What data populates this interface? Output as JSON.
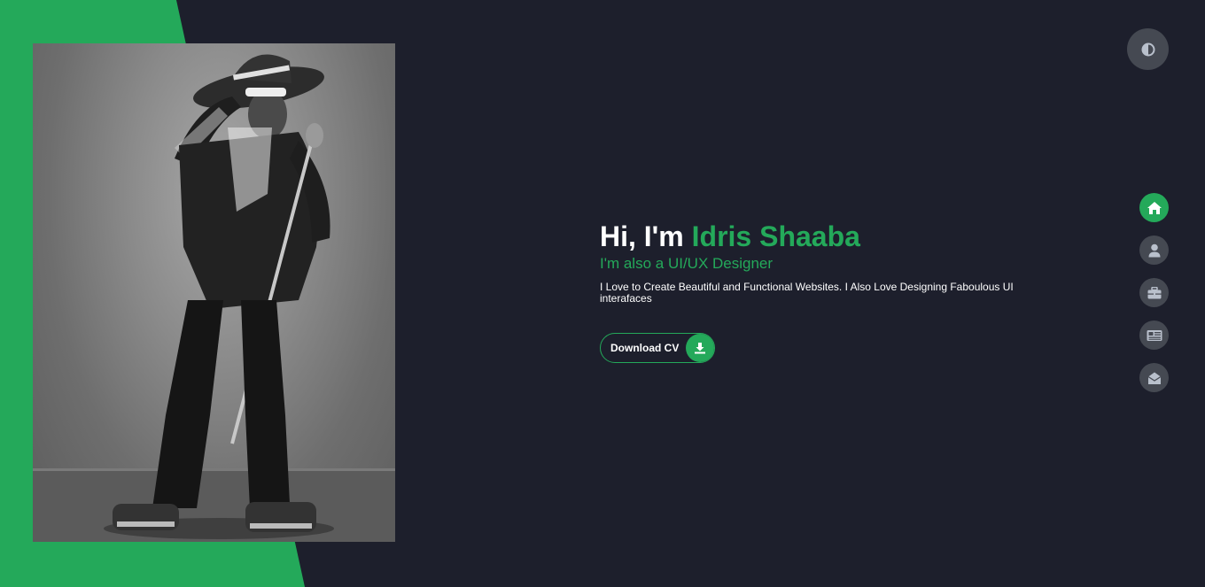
{
  "colors": {
    "accent": "#24a95a",
    "background": "#1d1f2c",
    "nav_button": "#454952",
    "icon_muted": "#b9c0cc",
    "text": "#ffffff"
  },
  "hero": {
    "greeting": "Hi, I'm",
    "name": "Idris Shaaba",
    "subtitle": "I'm also a UI/UX Designer",
    "description": "I Love to Create Beautiful and Functional Websites. I Also Love Designing Faboulous UI interafaces",
    "cta_label": "Download CV",
    "cta_icon": "download-icon"
  },
  "theme_toggle": {
    "icon": "contrast-icon"
  },
  "nav": {
    "items": [
      {
        "icon": "home-icon",
        "active": true
      },
      {
        "icon": "user-icon",
        "active": false
      },
      {
        "icon": "briefcase-icon",
        "active": false
      },
      {
        "icon": "newspaper-icon",
        "active": false
      },
      {
        "icon": "envelope-open-icon",
        "active": false
      }
    ]
  },
  "portrait": {
    "subject": "profile-photo"
  }
}
